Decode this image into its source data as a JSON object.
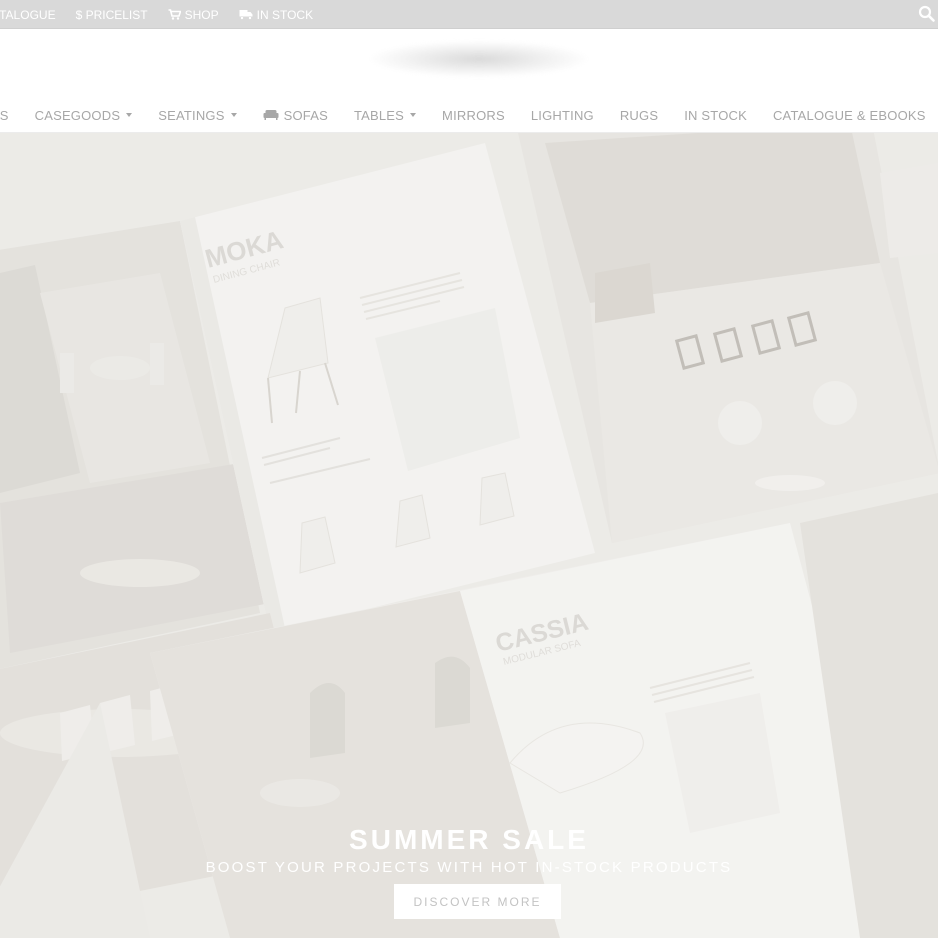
{
  "topbar": {
    "links": [
      {
        "label": "ATALOGUE",
        "icon": "catalogue-icon"
      },
      {
        "label": "$ PRICELIST",
        "icon": ""
      },
      {
        "label": "SHOP",
        "icon": "cart-icon"
      },
      {
        "label": "IN STOCK",
        "icon": "truck-icon"
      }
    ],
    "search_icon": "search-icon"
  },
  "nav": {
    "items": [
      {
        "label": "CTS",
        "has_dropdown": false
      },
      {
        "label": "CASEGOODS",
        "has_dropdown": true
      },
      {
        "label": "SEATINGS",
        "has_dropdown": true
      },
      {
        "label": "SOFAS",
        "has_dropdown": false,
        "icon": "sofa-icon"
      },
      {
        "label": "TABLES",
        "has_dropdown": true
      },
      {
        "label": "MIRRORS",
        "has_dropdown": false
      },
      {
        "label": "LIGHTING",
        "has_dropdown": false
      },
      {
        "label": "RUGS",
        "has_dropdown": false
      },
      {
        "label": "IN STOCK",
        "has_dropdown": false
      },
      {
        "label": "CATALOGUE & EBOOKS",
        "has_dropdown": false
      }
    ]
  },
  "hero": {
    "catalogue_pages": {
      "moka_title": "MOKA",
      "moka_subtitle": "DINING CHAIR",
      "cassia_title": "CASSIA",
      "cassia_subtitle": "MODULAR SOFA"
    },
    "title": "SUMMER SALE",
    "subtitle": "BOOST YOUR PROJECTS WITH HOT IN-STOCK PRODUCTS",
    "cta": "DISCOVER MORE"
  },
  "colors": {
    "topbar_bg": "#d9d9d9",
    "nav_text": "#a7a7a7",
    "hero_overlay": "#ecebe8",
    "cta_text": "#c3c3c3"
  }
}
